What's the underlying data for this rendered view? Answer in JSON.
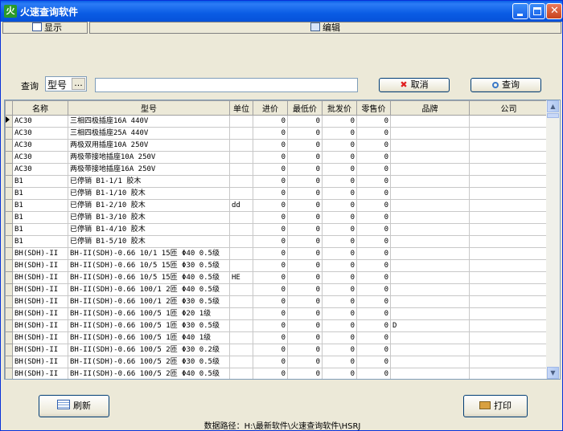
{
  "window": {
    "title": "火速查询软件",
    "app_icon": "火"
  },
  "toolbar": {
    "display_label": "显示",
    "edit_label": "编辑"
  },
  "query": {
    "label": "查询",
    "field_value": "型号",
    "field_button": "...",
    "input_value": "",
    "cancel_label": "取消",
    "search_label": "查询"
  },
  "table": {
    "columns": [
      "名称",
      "型号",
      "单位",
      "进价",
      "最低价",
      "批发价",
      "零售价",
      "品牌",
      "公司"
    ],
    "rows": [
      [
        "AC30",
        "三相四极插座16A 440V",
        "",
        "0",
        "0",
        "0",
        "0",
        "",
        ""
      ],
      [
        "AC30",
        "三相四极插座25A 440V",
        "",
        "0",
        "0",
        "0",
        "0",
        "",
        ""
      ],
      [
        "AC30",
        "两极双用插座10A 250V",
        "",
        "0",
        "0",
        "0",
        "0",
        "",
        ""
      ],
      [
        "AC30",
        "两极带接地插座10A 250V",
        "",
        "0",
        "0",
        "0",
        "0",
        "",
        ""
      ],
      [
        "AC30",
        "两极带接地插座16A 250V",
        "",
        "0",
        "0",
        "0",
        "0",
        "",
        ""
      ],
      [
        "B1",
        "已停销 B1-1/1 胶木",
        "",
        "0",
        "0",
        "0",
        "0",
        "",
        ""
      ],
      [
        "B1",
        "已停销 B1-1/10 胶木",
        "",
        "0",
        "0",
        "0",
        "0",
        "",
        ""
      ],
      [
        "B1",
        "已停销 B1-2/10 胶木",
        "dd",
        "0",
        "0",
        "0",
        "0",
        "",
        ""
      ],
      [
        "B1",
        "已停销 B1-3/10 胶木",
        "",
        "0",
        "0",
        "0",
        "0",
        "",
        ""
      ],
      [
        "B1",
        "已停销 B1-4/10 胶木",
        "",
        "0",
        "0",
        "0",
        "0",
        "",
        ""
      ],
      [
        "B1",
        "已停销 B1-5/10 胶木",
        "",
        "0",
        "0",
        "0",
        "0",
        "",
        ""
      ],
      [
        "BH(SDH)-II",
        "BH-II(SDH)-0.66 10/1 15匝 Φ40 0.5级",
        "",
        "0",
        "0",
        "0",
        "0",
        "",
        ""
      ],
      [
        "BH(SDH)-II",
        "BH-II(SDH)-0.66 10/5 15匝 Φ30 0.5级",
        "",
        "0",
        "0",
        "0",
        "0",
        "",
        ""
      ],
      [
        "BH(SDH)-II",
        "BH-II(SDH)-0.66 10/5 15匝 Φ40 0.5级",
        "HE",
        "0",
        "0",
        "0",
        "0",
        "",
        ""
      ],
      [
        "BH(SDH)-II",
        "BH-II(SDH)-0.66 100/1 2匝 Φ40 0.5级",
        "",
        "0",
        "0",
        "0",
        "0",
        "",
        ""
      ],
      [
        "BH(SDH)-II",
        "BH-II(SDH)-0.66 100/1 2匝 Φ30 0.5级",
        "",
        "0",
        "0",
        "0",
        "0",
        "",
        ""
      ],
      [
        "BH(SDH)-II",
        "BH-II(SDH)-0.66 100/5 1匝 Φ20 1级",
        "",
        "0",
        "0",
        "0",
        "0",
        "",
        ""
      ],
      [
        "BH(SDH)-II",
        "BH-II(SDH)-0.66 100/5 1匝 Φ30 0.5级",
        "",
        "0",
        "0",
        "0",
        "0",
        "D",
        ""
      ],
      [
        "BH(SDH)-II",
        "BH-II(SDH)-0.66 100/5 1匝 Φ40 1级",
        "",
        "0",
        "0",
        "0",
        "0",
        "",
        ""
      ],
      [
        "BH(SDH)-II",
        "BH-II(SDH)-0.66 100/5 2匝 Φ30 0.2级",
        "",
        "0",
        "0",
        "0",
        "0",
        "",
        ""
      ],
      [
        "BH(SDH)-II",
        "BH-II(SDH)-0.66 100/5 2匝 Φ30 0.5级",
        "",
        "0",
        "0",
        "0",
        "0",
        "",
        ""
      ],
      [
        "BH(SDH)-II",
        "BH-II(SDH)-0.66 100/5 2匝 Φ40 0.5级",
        "",
        "0",
        "0",
        "0",
        "0",
        "",
        ""
      ]
    ]
  },
  "buttons": {
    "refresh_label": "刷新",
    "print_label": "打印"
  },
  "footer": {
    "path": "数据路径：H:\\最新软件\\火速查询软件\\HSRJ"
  },
  "colors": {
    "titlebar": "#0a5ce4",
    "window_bg": "#ece9d8",
    "close": "#c8421c"
  }
}
